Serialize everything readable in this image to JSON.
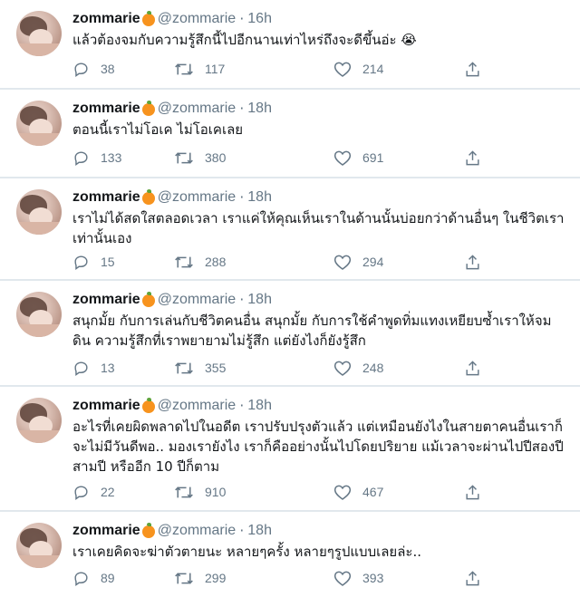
{
  "tweets": [
    {
      "name": "zommarie",
      "handle": "@zommarie",
      "time": "16h",
      "text": "แล้วต้องจมกับความรู้สึกนี้ไปอีกนานเท่าไหร่ถึงจะดีขึ้นอ่ะ 😭",
      "replies": "38",
      "retweets": "117",
      "likes": "214"
    },
    {
      "name": "zommarie",
      "handle": "@zommarie",
      "time": "18h",
      "text": "ตอนนี้เราไม่โอเค ไม่โอเคเลย",
      "replies": "133",
      "retweets": "380",
      "likes": "691"
    },
    {
      "name": "zommarie",
      "handle": "@zommarie",
      "time": "18h",
      "text": "เราไม่ได้สดใสตลอดเวลา เราแค่ให้คุณเห็นเราในด้านนั้นบ่อยกว่าด้านอื่นๆ ในชีวิตเราเท่านั้นเอง",
      "replies": "15",
      "retweets": "288",
      "likes": "294"
    },
    {
      "name": "zommarie",
      "handle": "@zommarie",
      "time": "18h",
      "text": "สนุกมั้ย กับการเล่นกับชีวิตคนอื่น สนุกมั้ย กับการใช้คำพูดทิ่มแทงเหยียบซ้ำเราให้จมดิน ความรู้สึกที่เราพยายามไม่รู้สึก แต่ยังไงก็ยังรู้สึก",
      "replies": "13",
      "retweets": "355",
      "likes": "248"
    },
    {
      "name": "zommarie",
      "handle": "@zommarie",
      "time": "18h",
      "text": "อะไรที่เคยผิดพลาดไปในอดีต เราปรับปรุงตัวแล้ว แต่เหมือนยังไงในสายตาคนอื่นเราก็จะไม่มีวันดีพอ.. มองเรายังไง เราก็คืออย่างนั้นไปโดยปริยาย แม้เวลาจะผ่านไปปีสองปี สามปี หรืออีก 10 ปีก็ตาม",
      "replies": "22",
      "retweets": "910",
      "likes": "467"
    },
    {
      "name": "zommarie",
      "handle": "@zommarie",
      "time": "18h",
      "text": "เราเคยคิดจะฆ่าตัวตายนะ หลายๆครั้ง หลายๆรูปแบบเลยล่ะ..",
      "replies": "89",
      "retweets": "299",
      "likes": "393"
    }
  ],
  "icons": {
    "reply": "reply-icon",
    "retweet": "retweet-icon",
    "like": "heart-icon",
    "share": "share-icon",
    "emoji": "orange-emoji"
  },
  "colors": {
    "text": "#14171a",
    "muted": "#657786",
    "border": "#e1e8ed",
    "orange": "#f7931e"
  }
}
